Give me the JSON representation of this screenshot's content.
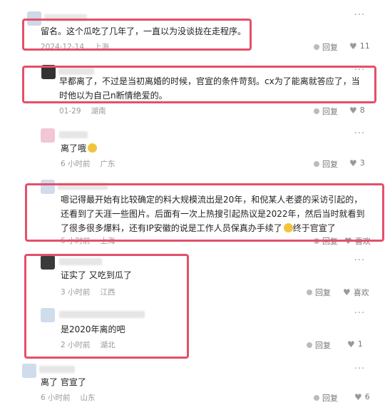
{
  "comments": [
    {
      "text": "留名。这个瓜吃了几年了，一直以为没谈拢在走程序。",
      "date": "2024-12-14",
      "location": "上海",
      "reply": "回复",
      "likes": "11"
    },
    {
      "text": "早都离了，不过是当初离婚的时候，官宣的条件苛刻。cx为了能离就答应了，当时他以为自己n断情绝爱的。",
      "date": "01-29",
      "location": "湖南",
      "reply": "回复",
      "likes": "8"
    },
    {
      "text": "离了哦",
      "date": "6 小时前",
      "location": "广东",
      "reply": "回复",
      "likes": "3"
    },
    {
      "text": "嗯记得最开始有比较确定的料大规模流出是20年，和倪某人老婆的采访引起的，还看到了天涯一些图片。后面有一次上热搜引起热议是2022年，然后当时就看到了很多很多爆料，还有IP安徽的说是工作人员保真办手续了",
      "text_tail": "终于官宣了",
      "date": "6 小时前",
      "location": "上海",
      "reply": "回复",
      "likes": "喜欢"
    },
    {
      "text": "证实了 又吃到瓜了",
      "date": "3 小时前",
      "location": "江西",
      "reply": "回复",
      "likes": "喜欢"
    },
    {
      "text": "是2020年离的吧",
      "date": "2 小时前",
      "location": "湖北",
      "reply": "回复",
      "likes": "1"
    },
    {
      "text": "离了 官宣了",
      "date": "6 小时前",
      "location": "山东",
      "reply": "回复",
      "likes": "6"
    }
  ],
  "more_label": "···",
  "colors": {
    "highlight": "#e4506a"
  }
}
